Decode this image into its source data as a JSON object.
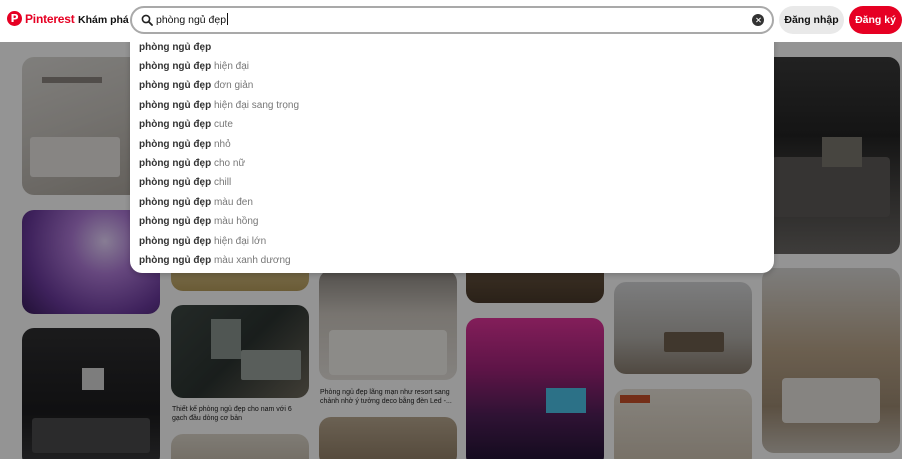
{
  "header": {
    "logo_text": "Pinterest",
    "logo_glyph": "P",
    "explore_label": "Khám phá",
    "search_value": "phòng ngủ đẹp",
    "login_label": "Đăng nhập",
    "signup_label": "Đăng ký",
    "brand_color": "#e60023"
  },
  "suggestions": [
    {
      "prefix": "phòng ngủ đẹp",
      "suffix": ""
    },
    {
      "prefix": "phòng ngủ đẹp",
      "suffix": " hiện đại"
    },
    {
      "prefix": "phòng ngủ đẹp",
      "suffix": " đơn giản"
    },
    {
      "prefix": "phòng ngủ đẹp",
      "suffix": " hiện đại sang trọng"
    },
    {
      "prefix": "phòng ngủ đẹp",
      "suffix": " cute"
    },
    {
      "prefix": "phòng ngủ đẹp",
      "suffix": " nhỏ"
    },
    {
      "prefix": "phòng ngủ đẹp",
      "suffix": " cho nữ"
    },
    {
      "prefix": "phòng ngủ đẹp",
      "suffix": " chill"
    },
    {
      "prefix": "phòng ngủ đẹp",
      "suffix": " màu đen"
    },
    {
      "prefix": "phòng ngủ đẹp",
      "suffix": " màu hồng"
    },
    {
      "prefix": "phòng ngủ đẹp",
      "suffix": " hiện đại lớn"
    },
    {
      "prefix": "phòng ngủ đẹp",
      "suffix": " màu xanh dương"
    }
  ],
  "pins": {
    "caption_1": "Thiết kế phòng ngủ đẹp cho nam với 6 gạch đầu dòng cơ bản",
    "caption_2": "Phòng ngủ đẹp lãng mạn như resort sang chảnh nhờ ý tưởng deco bằng đèn Led -..."
  }
}
